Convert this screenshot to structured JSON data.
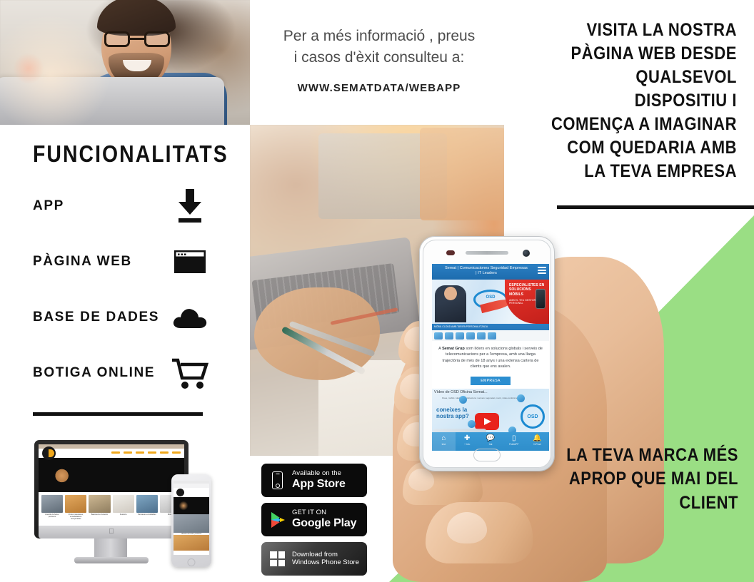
{
  "colors": {
    "green": "#9ade84",
    "black": "#111111",
    "phone_blue": "#2b8ed0",
    "phone_red": "#d8261f",
    "body_gray": "#4c4c4c"
  },
  "mid_top": {
    "intro_line1": "Per a més informació , preus",
    "intro_line2": "i casos d'èxit consulteu a:",
    "url": "WWW.SEMATDATA/WEBAPP"
  },
  "right": {
    "headline": "VISITA LA NOSTRA PÀGINA WEB DESDE QUALSEVOL DISPOSITIU I COMENÇA A IMAGINAR COM QUEDARIA AMB LA TEVA EMPRESA",
    "footline": "LA TEVA MARCA MÉS APROP QUE MAI DEL CLIENT"
  },
  "features": {
    "title": "FUNCIONALITATS",
    "items": [
      {
        "label": "APP",
        "icon": "download-icon"
      },
      {
        "label": "PÀGINA WEB",
        "icon": "browser-window-icon"
      },
      {
        "label": "BASE DE DADES",
        "icon": "cloud-icon"
      },
      {
        "label": "BOTIGA ONLINE",
        "icon": "shopping-cart-icon"
      }
    ]
  },
  "badges": [
    {
      "name": "app-store-badge",
      "line1": "Available on the",
      "line2": "App Store",
      "icon": "iphone-icon"
    },
    {
      "name": "google-play-badge",
      "line1": "GET IT ON",
      "line2": "Google Play",
      "icon": "google-play-triangle-icon"
    },
    {
      "name": "windows-store-badge",
      "line1": "Download from",
      "line2": "Windows Phone Store",
      "icon": "windows-logo-icon"
    }
  ],
  "phone": {
    "site_title_line1": "Semat | Comunicaciones Seguridad Empresas",
    "site_title_line2": "| IT Leaders",
    "promo_title": "ESPECIALISTES EN SOLUCIONS MÒBILS",
    "promo_sub": "AMB EL TEU GESTOR PERSONAL",
    "strip_text": "MÒBIL  CLOUD  AMB TARIFA PERSONALITZADA",
    "body_prefix": "A ",
    "body_brand": "Semat Grup",
    "body_rest": " som líders en solucions globals i serveis de telecomunicacions per a l'empresa, amb una llarga trajectòria de més de 18 anys i una extensa cartera de clients que ens avalen.",
    "cta": "EMPRESA",
    "video_title": "Vídeo de OSD Oficina Semat...",
    "video_sub": "Fixes, mòbils i dades en aplicacions i serveis: seguretat, núvol, vídeo-conferència, etc.",
    "video_claim_l1": "coneixes la",
    "video_claim_l2": "nostra app?",
    "osd_label": "OSD",
    "nav": [
      {
        "label": "Inici",
        "glyph": "⌂",
        "icon": "home-icon",
        "active": true
      },
      {
        "label": "+ Info",
        "glyph": "✚",
        "icon": "plus-icon",
        "active": false
      },
      {
        "label": "Xat",
        "glyph": "💬",
        "icon": "chat-icon",
        "active": false
      },
      {
        "label": "FidelAPP",
        "glyph": "▭",
        "icon": "card-icon",
        "active": false
      },
      {
        "label": "N.Push",
        "glyph": "🔔",
        "icon": "bell-icon",
        "active": false
      }
    ]
  },
  "devices_mockup": {
    "imac_nav": [
      "Inici",
      "Productes",
      "Clients",
      "Galeria",
      "Contacte",
      "Ca"
    ],
    "cards": [
      "Llistells de fusta i porticons",
      "Portes massisses, encadellades i recuperades",
      "Basiments d'exterior",
      "Fusteria",
      "Persianes enrotllables",
      "Motors"
    ],
    "phone_caption": "Llistells de fusta i porticons"
  }
}
